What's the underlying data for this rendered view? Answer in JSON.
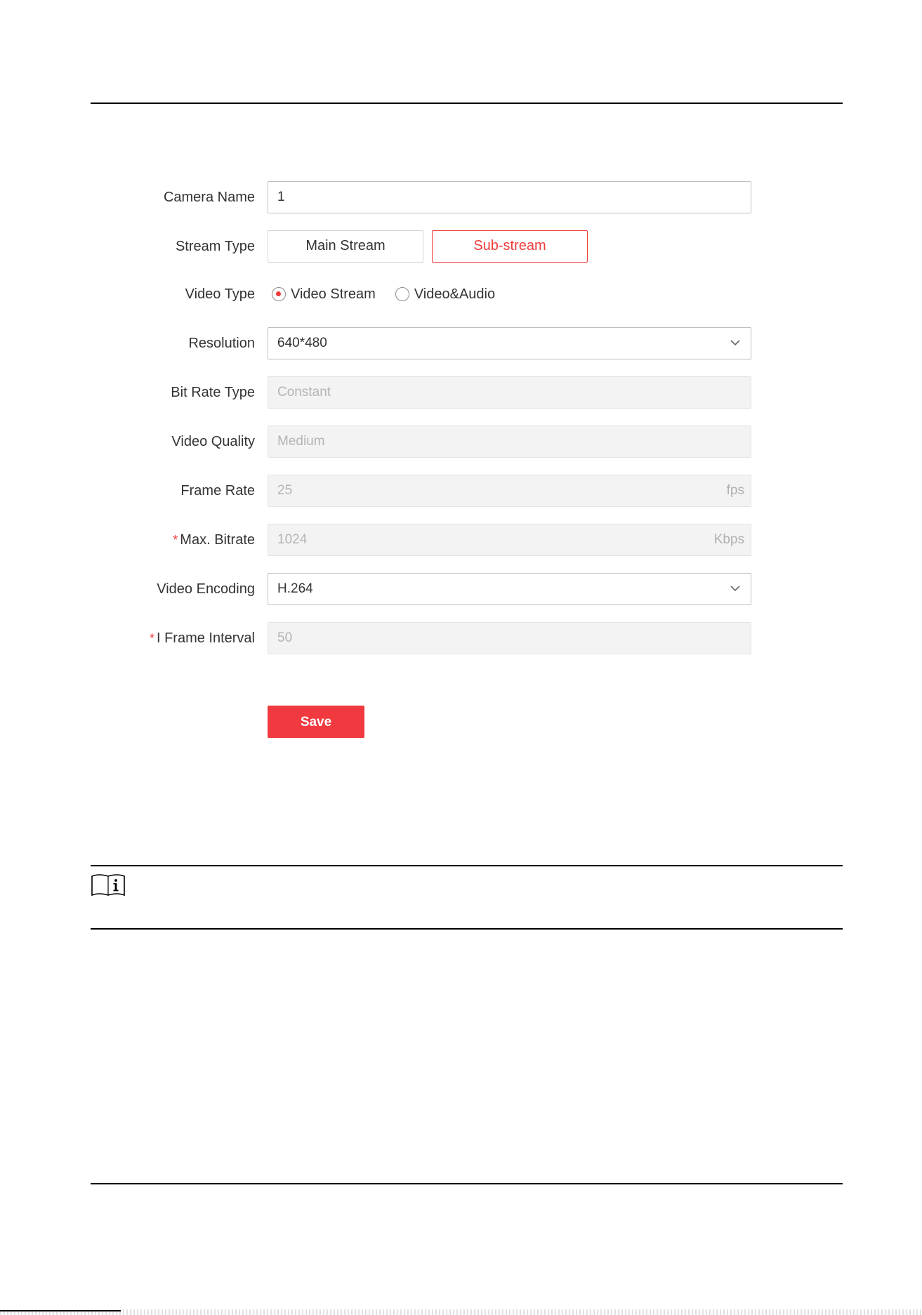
{
  "form": {
    "camera_name": {
      "label": "Camera Name",
      "value": "1"
    },
    "stream_type": {
      "label": "Stream Type",
      "options": [
        "Main Stream",
        "Sub-stream"
      ],
      "selected": "Sub-stream"
    },
    "video_type": {
      "label": "Video Type",
      "options": [
        "Video Stream",
        "Video&Audio"
      ],
      "selected": "Video Stream"
    },
    "resolution": {
      "label": "Resolution",
      "value": "640*480"
    },
    "bit_rate_type": {
      "label": "Bit Rate Type",
      "value": "Constant"
    },
    "video_quality": {
      "label": "Video Quality",
      "value": "Medium"
    },
    "frame_rate": {
      "label": "Frame Rate",
      "value": "25",
      "unit": "fps"
    },
    "max_bitrate": {
      "label": "Max. Bitrate",
      "required_mark": "*",
      "value": "1024",
      "unit": "Kbps"
    },
    "video_encoding": {
      "label": "Video Encoding",
      "value": "H.264"
    },
    "i_frame_interval": {
      "label": "I Frame Interval",
      "required_mark": "*",
      "value": "50"
    },
    "save_label": "Save"
  },
  "colors": {
    "accent": "#ef3b3b",
    "disabled_bg": "#f3f3f3",
    "disabled_text": "#b4b4b4"
  },
  "icons": {
    "note": "note-book-info-icon",
    "dropdown": "chevron-down-icon"
  }
}
